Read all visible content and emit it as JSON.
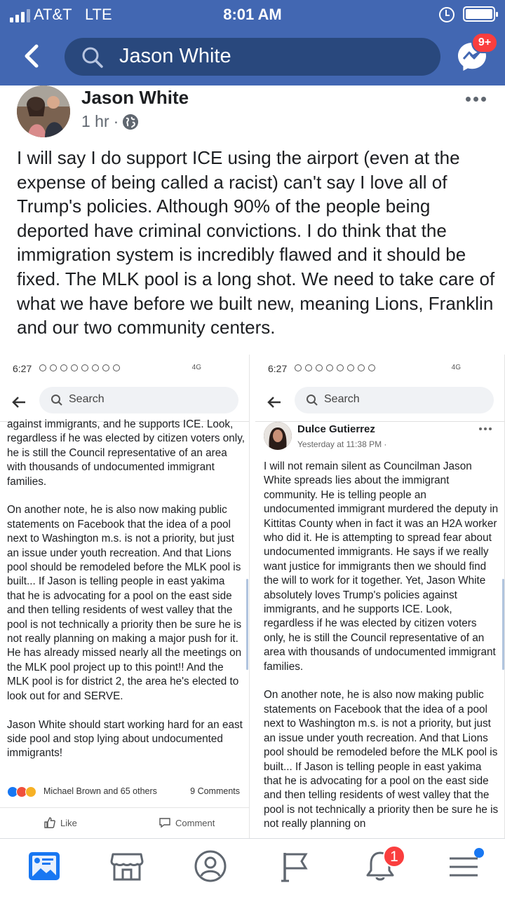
{
  "status_bar": {
    "carrier": "AT&T",
    "network": "LTE",
    "time": "8:01 AM"
  },
  "search": {
    "query": "Jason White"
  },
  "messenger": {
    "badge": "9+"
  },
  "post": {
    "author": "Jason White",
    "time": "1 hr",
    "separator": "·",
    "body": "I will say I do support ICE using the airport (even at the expense of being called a racist) can't say I love all of Trump's policies. Although 90% of the people being deported have criminal convictions. I do think that the immigration system is incredibly flawed and it should be fixed. The MLK pool is a long shot. We need to take care of what we have before we built new, meaning Lions, Franklin and our two community centers."
  },
  "screenshot_left": {
    "status_time": "6:27",
    "status_signal": "4G",
    "search_placeholder": "Search",
    "paragraphs": [
      "against immigrants, and he supports ICE. Look, regardless if he was elected by citizen voters only, he is still the Council representative of an area with thousands of undocumented immigrant families.",
      "On another note, he is also now making public statements on Facebook that the idea of a pool next to Washington m.s. is not a priority, but just an issue under youth recreation. And that Lions pool should be remodeled before the MLK pool is built... If Jason is telling people in east yakima that he is advocating for a pool on the east side and then telling residents of west valley that the pool is not technically a priority then be sure he is not really planning on making a major push for it. He has already missed nearly all the meetings on the MLK pool project up to this point!! And the MLK pool is for district 2, the area he's elected to look out for and SERVE.",
      "Jason White should start working hard for an east side pool and stop lying about undocumented immigrants!"
    ],
    "reactions_text": "Michael Brown and 65 others",
    "comments_text": "9 Comments",
    "like_label": "Like",
    "comment_label": "Comment"
  },
  "screenshot_right": {
    "status_time": "6:27",
    "status_signal": "4G",
    "search_placeholder": "Search",
    "author": "Dulce Gutierrez",
    "meta": "Yesterday at 11:38 PM ·",
    "paragraphs": [
      "I will not remain silent as Councilman Jason White spreads lies about the immigrant community. He is telling people an undocumented immigrant murdered the deputy in Kittitas County when in fact it was an H2A worker who did it. He is attempting to spread fear about undocumented immigrants. He says if we really want justice for immigrants then we should find the will to work for it together. Yet, Jason White absolutely loves Trump's policies against immigrants, and he supports ICE. Look, regardless if he was elected by citizen voters only, he is still the Council representative of an area with thousands of undocumented immigrant families.",
      "On another note, he is also now making public statements on Facebook that the idea of a pool next to Washington m.s. is not a priority, but just an issue under youth recreation. And that Lions pool should be remodeled before the MLK pool is built... If Jason is telling people in east yakima that he is advocating for a pool on the east side and then telling residents of west valley that the pool is not technically a priority then be sure he is not really planning on"
    ]
  },
  "tabbar": {
    "notifications_badge": "1",
    "icons": [
      "news-feed-icon",
      "marketplace-icon",
      "profile-icon",
      "pages-flag-icon",
      "notifications-bell-icon",
      "menu-icon"
    ]
  },
  "colors": {
    "brand_blue": "#4267b2",
    "search_bg": "#29487d",
    "badge_red": "#fa3e3e"
  }
}
